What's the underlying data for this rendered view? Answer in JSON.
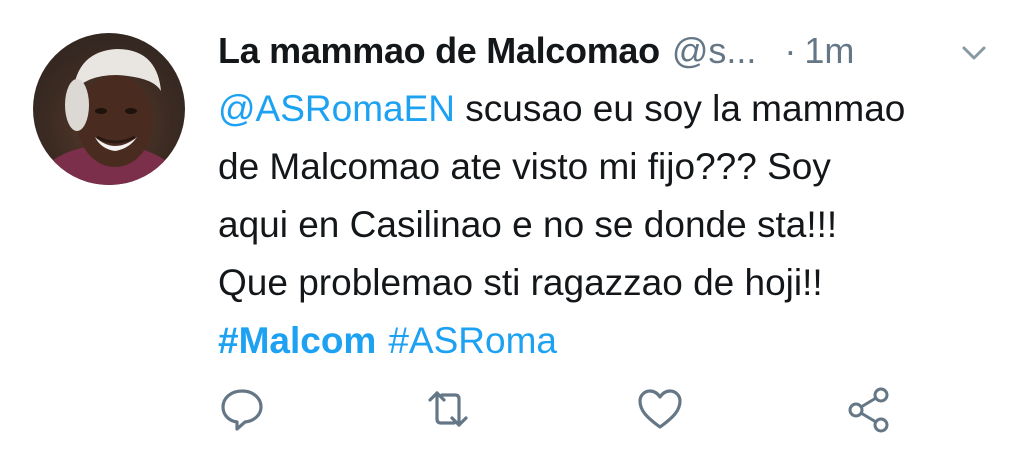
{
  "tweet": {
    "display_name": "La mammao de Malcomao",
    "handle": "@s...",
    "separator": "·",
    "time": "1m",
    "text": {
      "mention": "@ASRomaEN",
      "line1_rest": " scusao eu soy la mammao",
      "line2": "de Malcomao ate visto mi fijo??? Soy",
      "line3": "aqui en Casilinao e no se donde sta!!!",
      "line4": "Que problemao sti ragazzao de hoji!!"
    },
    "hashtags": [
      "#Malcom",
      "#ASRoma"
    ]
  },
  "actions": [
    {
      "icon": "reply-icon"
    },
    {
      "icon": "retweet-icon"
    },
    {
      "icon": "like-icon"
    },
    {
      "icon": "share-icon"
    }
  ],
  "colors": {
    "link": "#1da1f2",
    "text": "#14171a",
    "secondary": "#657786",
    "icon": "#657786"
  }
}
